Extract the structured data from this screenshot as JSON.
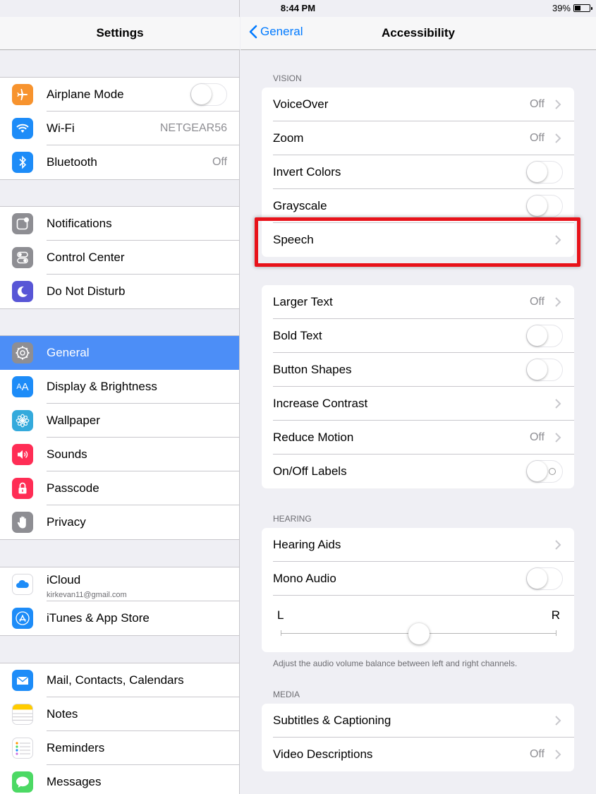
{
  "status_bar": {
    "device": "iPad",
    "time": "8:44 PM",
    "battery": "39%",
    "battery_level": 0.39
  },
  "sidebar": {
    "title": "Settings",
    "groups": [
      {
        "items": [
          {
            "label": "Airplane Mode",
            "icon": "airplane-icon",
            "color": "#f7932e",
            "toggle": false
          },
          {
            "label": "Wi-Fi",
            "icon": "wifi-icon",
            "color": "#1d8cf8",
            "value": "NETGEAR56"
          },
          {
            "label": "Bluetooth",
            "icon": "bluetooth-icon",
            "color": "#1d8cf8",
            "value": "Off"
          }
        ]
      },
      {
        "items": [
          {
            "label": "Notifications",
            "icon": "notifications-icon",
            "color": "#8e8e93"
          },
          {
            "label": "Control Center",
            "icon": "control-center-icon",
            "color": "#8e8e93"
          },
          {
            "label": "Do Not Disturb",
            "icon": "moon-icon",
            "color": "#5856d6"
          }
        ]
      },
      {
        "items": [
          {
            "label": "General",
            "icon": "gear-icon",
            "color": "#8e8e93",
            "selected": true
          },
          {
            "label": "Display & Brightness",
            "icon": "display-icon",
            "color": "#1d8cf8"
          },
          {
            "label": "Wallpaper",
            "icon": "wallpaper-icon",
            "color": "#34aadc"
          },
          {
            "label": "Sounds",
            "icon": "speaker-icon",
            "color": "#ff2d55"
          },
          {
            "label": "Passcode",
            "icon": "lock-icon",
            "color": "#ff2d55"
          },
          {
            "label": "Privacy",
            "icon": "hand-icon",
            "color": "#8e8e93"
          }
        ]
      },
      {
        "items": [
          {
            "label": "iCloud",
            "sublabel": "kirkevan11@gmail.com",
            "icon": "cloud-icon",
            "color": "#ffffff"
          },
          {
            "label": "iTunes & App Store",
            "icon": "app-store-icon",
            "color": "#1d8cf8"
          }
        ]
      },
      {
        "items": [
          {
            "label": "Mail, Contacts, Calendars",
            "icon": "mail-icon",
            "color": "#1d8cf8"
          },
          {
            "label": "Notes",
            "icon": "notes-icon",
            "color": "#ffcc00"
          },
          {
            "label": "Reminders",
            "icon": "reminders-icon",
            "color": "#ffffff"
          },
          {
            "label": "Messages",
            "icon": "messages-icon",
            "color": "#4cd964"
          }
        ]
      }
    ]
  },
  "detail": {
    "back_label": "General",
    "title": "Accessibility",
    "vision": {
      "header": "VISION",
      "rows": [
        {
          "label": "VoiceOver",
          "value": "Off",
          "chevron": true
        },
        {
          "label": "Zoom",
          "value": "Off",
          "chevron": true
        },
        {
          "label": "Invert Colors",
          "toggle": false
        },
        {
          "label": "Grayscale",
          "toggle": false
        },
        {
          "label": "Speech",
          "chevron": true
        }
      ]
    },
    "display": {
      "rows": [
        {
          "label": "Larger Text",
          "value": "Off",
          "chevron": true
        },
        {
          "label": "Bold Text",
          "toggle": false
        },
        {
          "label": "Button Shapes",
          "toggle": false
        },
        {
          "label": "Increase Contrast",
          "chevron": true
        },
        {
          "label": "Reduce Motion",
          "value": "Off",
          "chevron": true
        },
        {
          "label": "On/Off Labels",
          "toggle": false
        }
      ]
    },
    "hearing": {
      "header": "HEARING",
      "rows": [
        {
          "label": "Hearing Aids",
          "chevron": true
        },
        {
          "label": "Mono Audio",
          "toggle": false
        }
      ],
      "balance": {
        "left": "L",
        "right": "R",
        "value": 0.5
      },
      "footer": "Adjust the audio volume balance between left and right channels."
    },
    "media": {
      "header": "MEDIA",
      "rows": [
        {
          "label": "Subtitles & Captioning",
          "chevron": true
        },
        {
          "label": "Video Descriptions",
          "value": "Off",
          "chevron": true
        }
      ]
    }
  },
  "highlight_color": "#e8121a"
}
